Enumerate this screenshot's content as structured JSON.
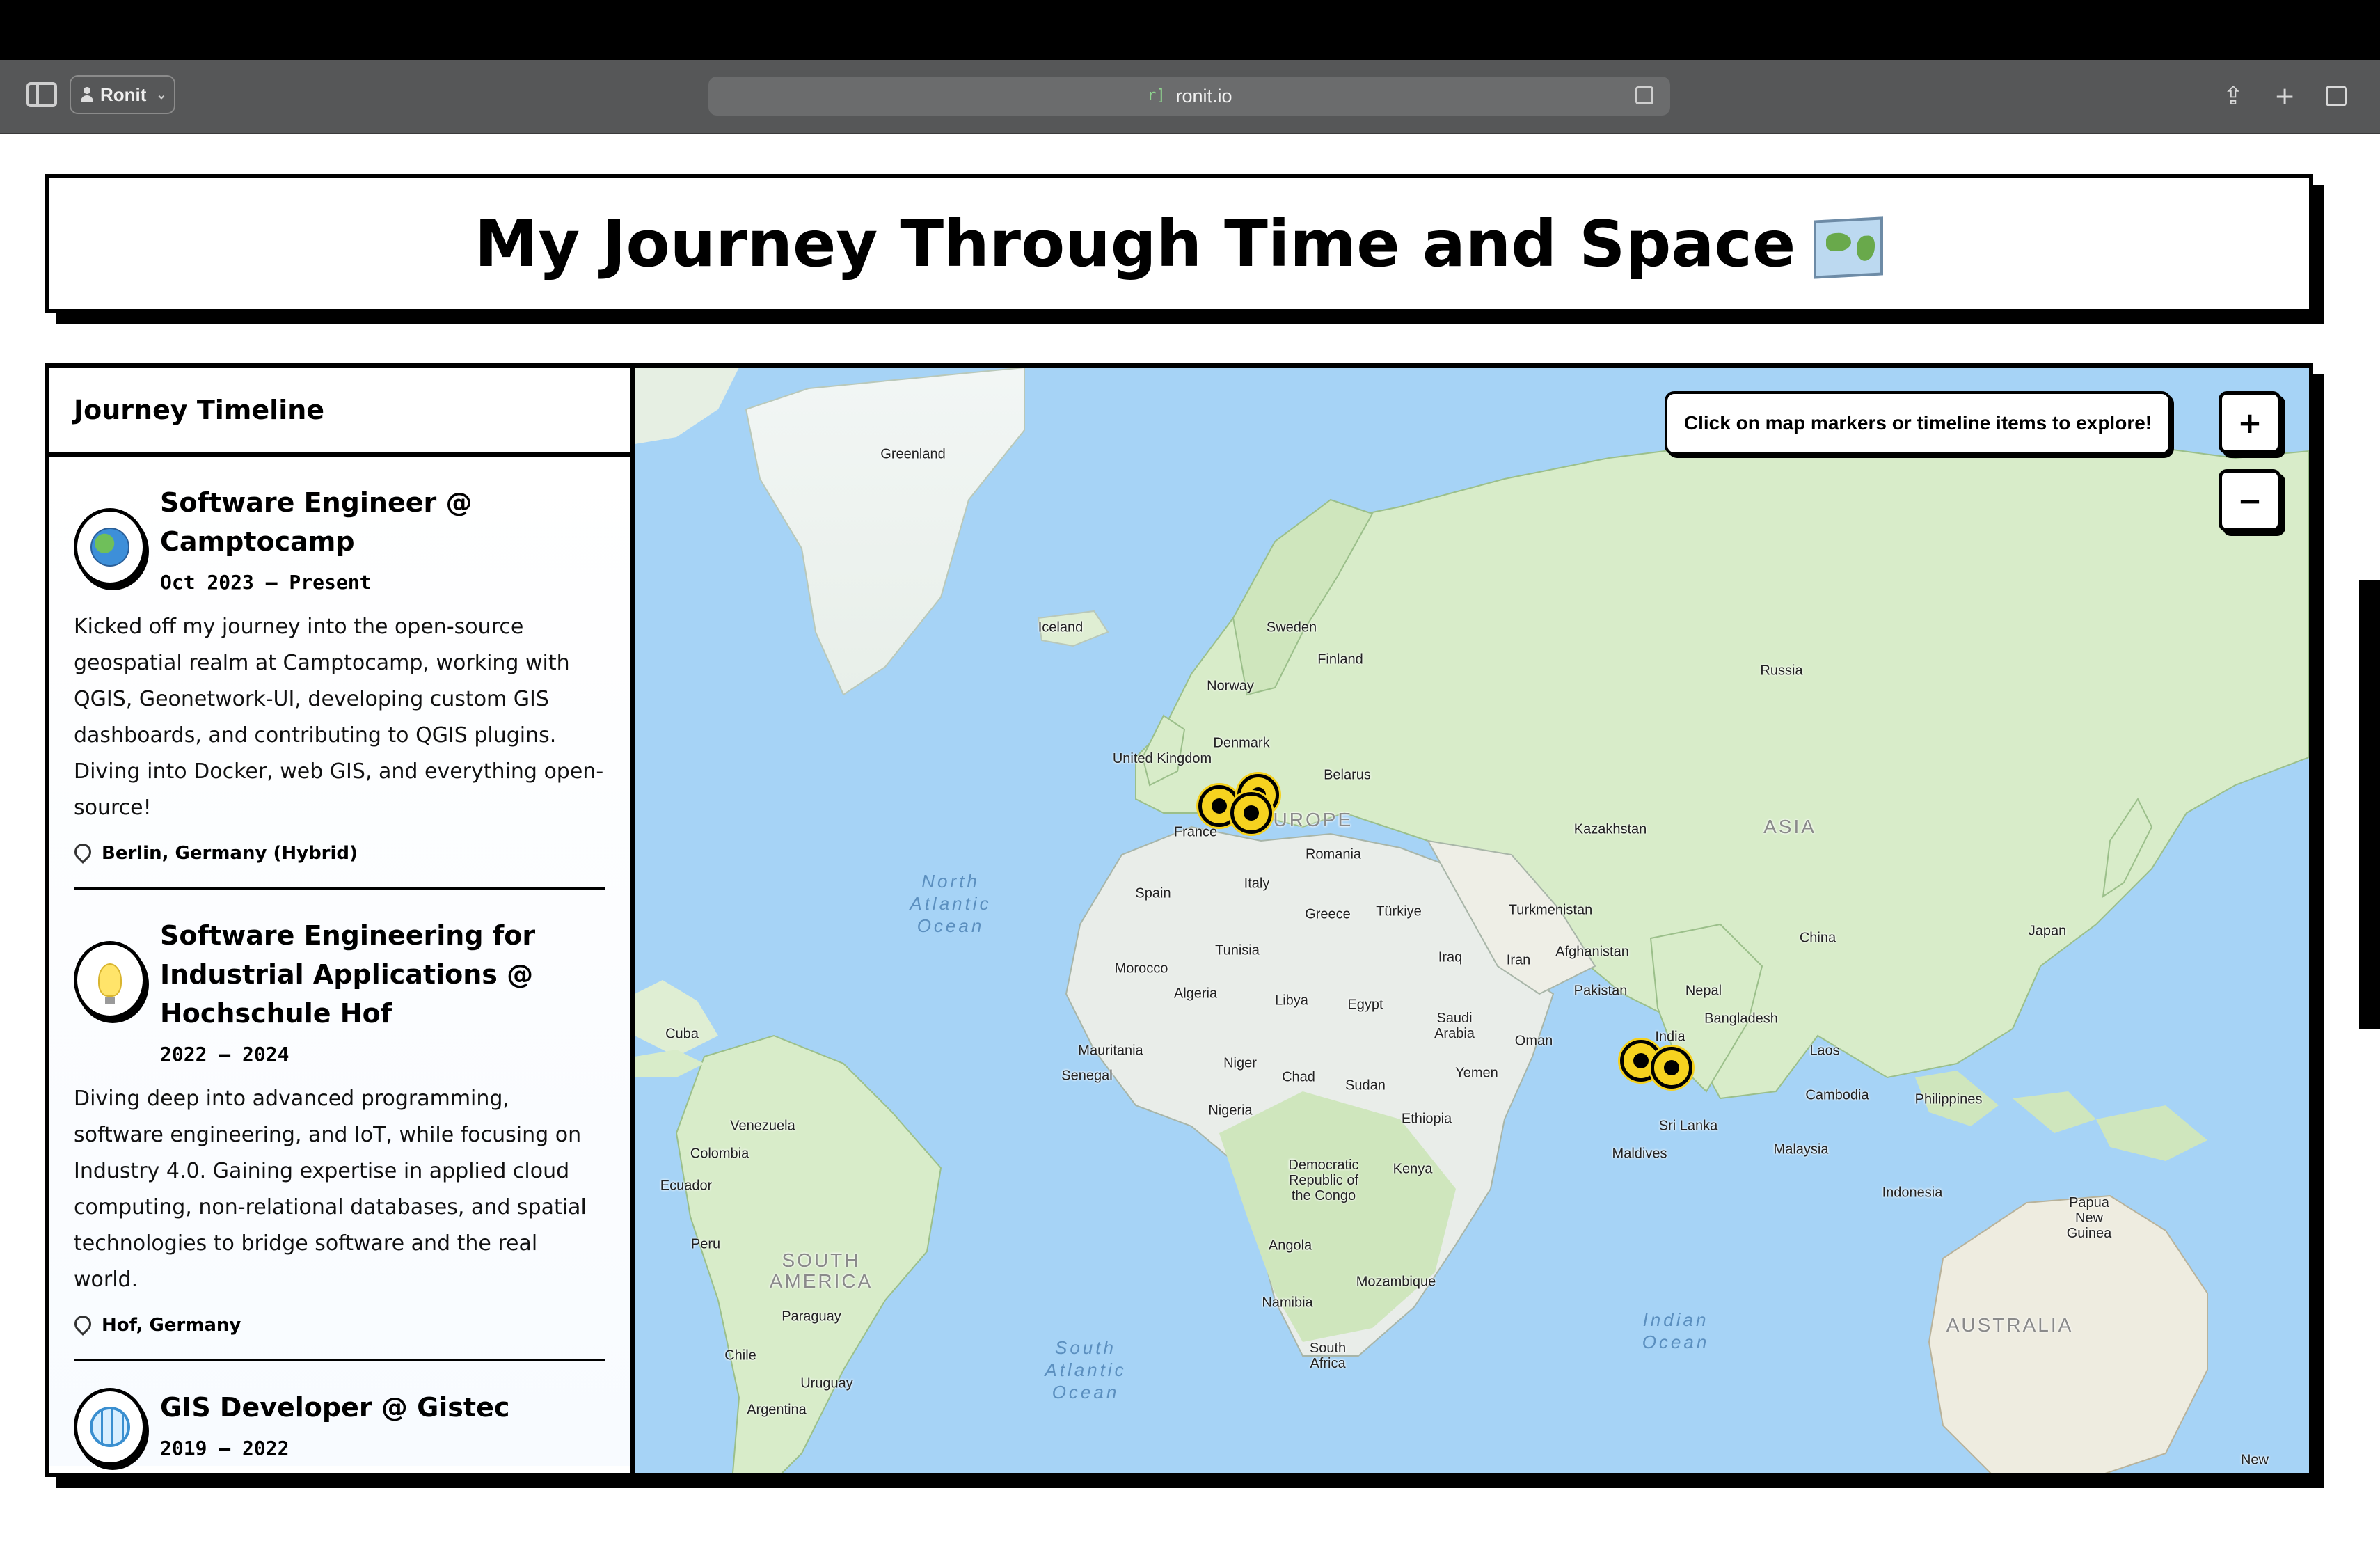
{
  "browser": {
    "profile_name": "Ronit",
    "url": "ronit.io"
  },
  "page": {
    "title": "My Journey Through Time and Space",
    "sidebar_title": "Journey Timeline",
    "hint": "Click on map markers or timeline items to explore!",
    "zoom_in_label": "+",
    "zoom_out_label": "−"
  },
  "timeline": [
    {
      "icon": "earth-globe-icon",
      "title": "Software Engineer @ Camptocamp",
      "date": "Oct 2023 – Present",
      "description": "Kicked off my journey into the open-source geospatial realm at Camptocamp, working with QGIS, Geonetwork-UI, developing custom GIS dashboards, and contributing to QGIS plugins. Diving into Docker, web GIS, and everything open-source!",
      "location": "Berlin, Germany (Hybrid)"
    },
    {
      "icon": "light-bulb-icon",
      "title": "Software Engineering for Industrial Applications @ Hochschule Hof",
      "date": "2022 – 2024",
      "description": "Diving deep into advanced programming, software engineering, and IoT, while focusing on Industry 4.0. Gaining expertise in applied cloud computing, non-relational databases, and spatial technologies to bridge software and the real world.",
      "location": "Hof, Germany"
    },
    {
      "icon": "web-globe-icon",
      "title": "GIS Developer @ Gistec",
      "date": "2019 – 2022",
      "description": "",
      "location": ""
    }
  ],
  "map_labels": {
    "countries": [
      "Greenland",
      "Iceland",
      "Sweden",
      "Finland",
      "Norway",
      "Russia",
      "United Kingdom",
      "Denmark",
      "Belarus",
      "France",
      "Kazakhstan",
      "Romania",
      "Spain",
      "Italy",
      "Greece",
      "Türkiye",
      "Turkmenistan",
      "Japan",
      "Tunisia",
      "Iraq",
      "Iran",
      "Afghanistan",
      "China",
      "Morocco",
      "Algeria",
      "Libya",
      "Egypt",
      "Pakistan",
      "Nepal",
      "Saudi Arabia",
      "Bangladesh",
      "India",
      "Oman",
      "Cuba",
      "Mauritania",
      "Laos",
      "Niger",
      "Chad",
      "Sudan",
      "Yemen",
      "Senegal",
      "Cambodia",
      "Philippines",
      "Nigeria",
      "Ethiopia",
      "Venezuela",
      "Sri Lanka",
      "Colombia",
      "Malaysia",
      "Maldives",
      "Democratic Republic of the Congo",
      "Kenya",
      "Ecuador",
      "Indonesia",
      "Papua New Guinea",
      "Peru",
      "Angola",
      "Mozambique",
      "Namibia",
      "Paraguay",
      "Chile",
      "South Africa",
      "Uruguay",
      "Argentina",
      "New"
    ],
    "continents": [
      "EUROPE",
      "ASIA",
      "SOUTH AMERICA",
      "AUSTRALIA"
    ],
    "oceans": [
      "North Atlantic Ocean",
      "South Atlantic Ocean",
      "Indian Ocean"
    ]
  },
  "markers": [
    "marker-berlin",
    "marker-hof",
    "marker-europe",
    "marker-india-west",
    "marker-india-south"
  ],
  "colors": {
    "ocean": "#a6d3f6",
    "land": "#d8ecc9",
    "marker": "#f6d21f"
  }
}
